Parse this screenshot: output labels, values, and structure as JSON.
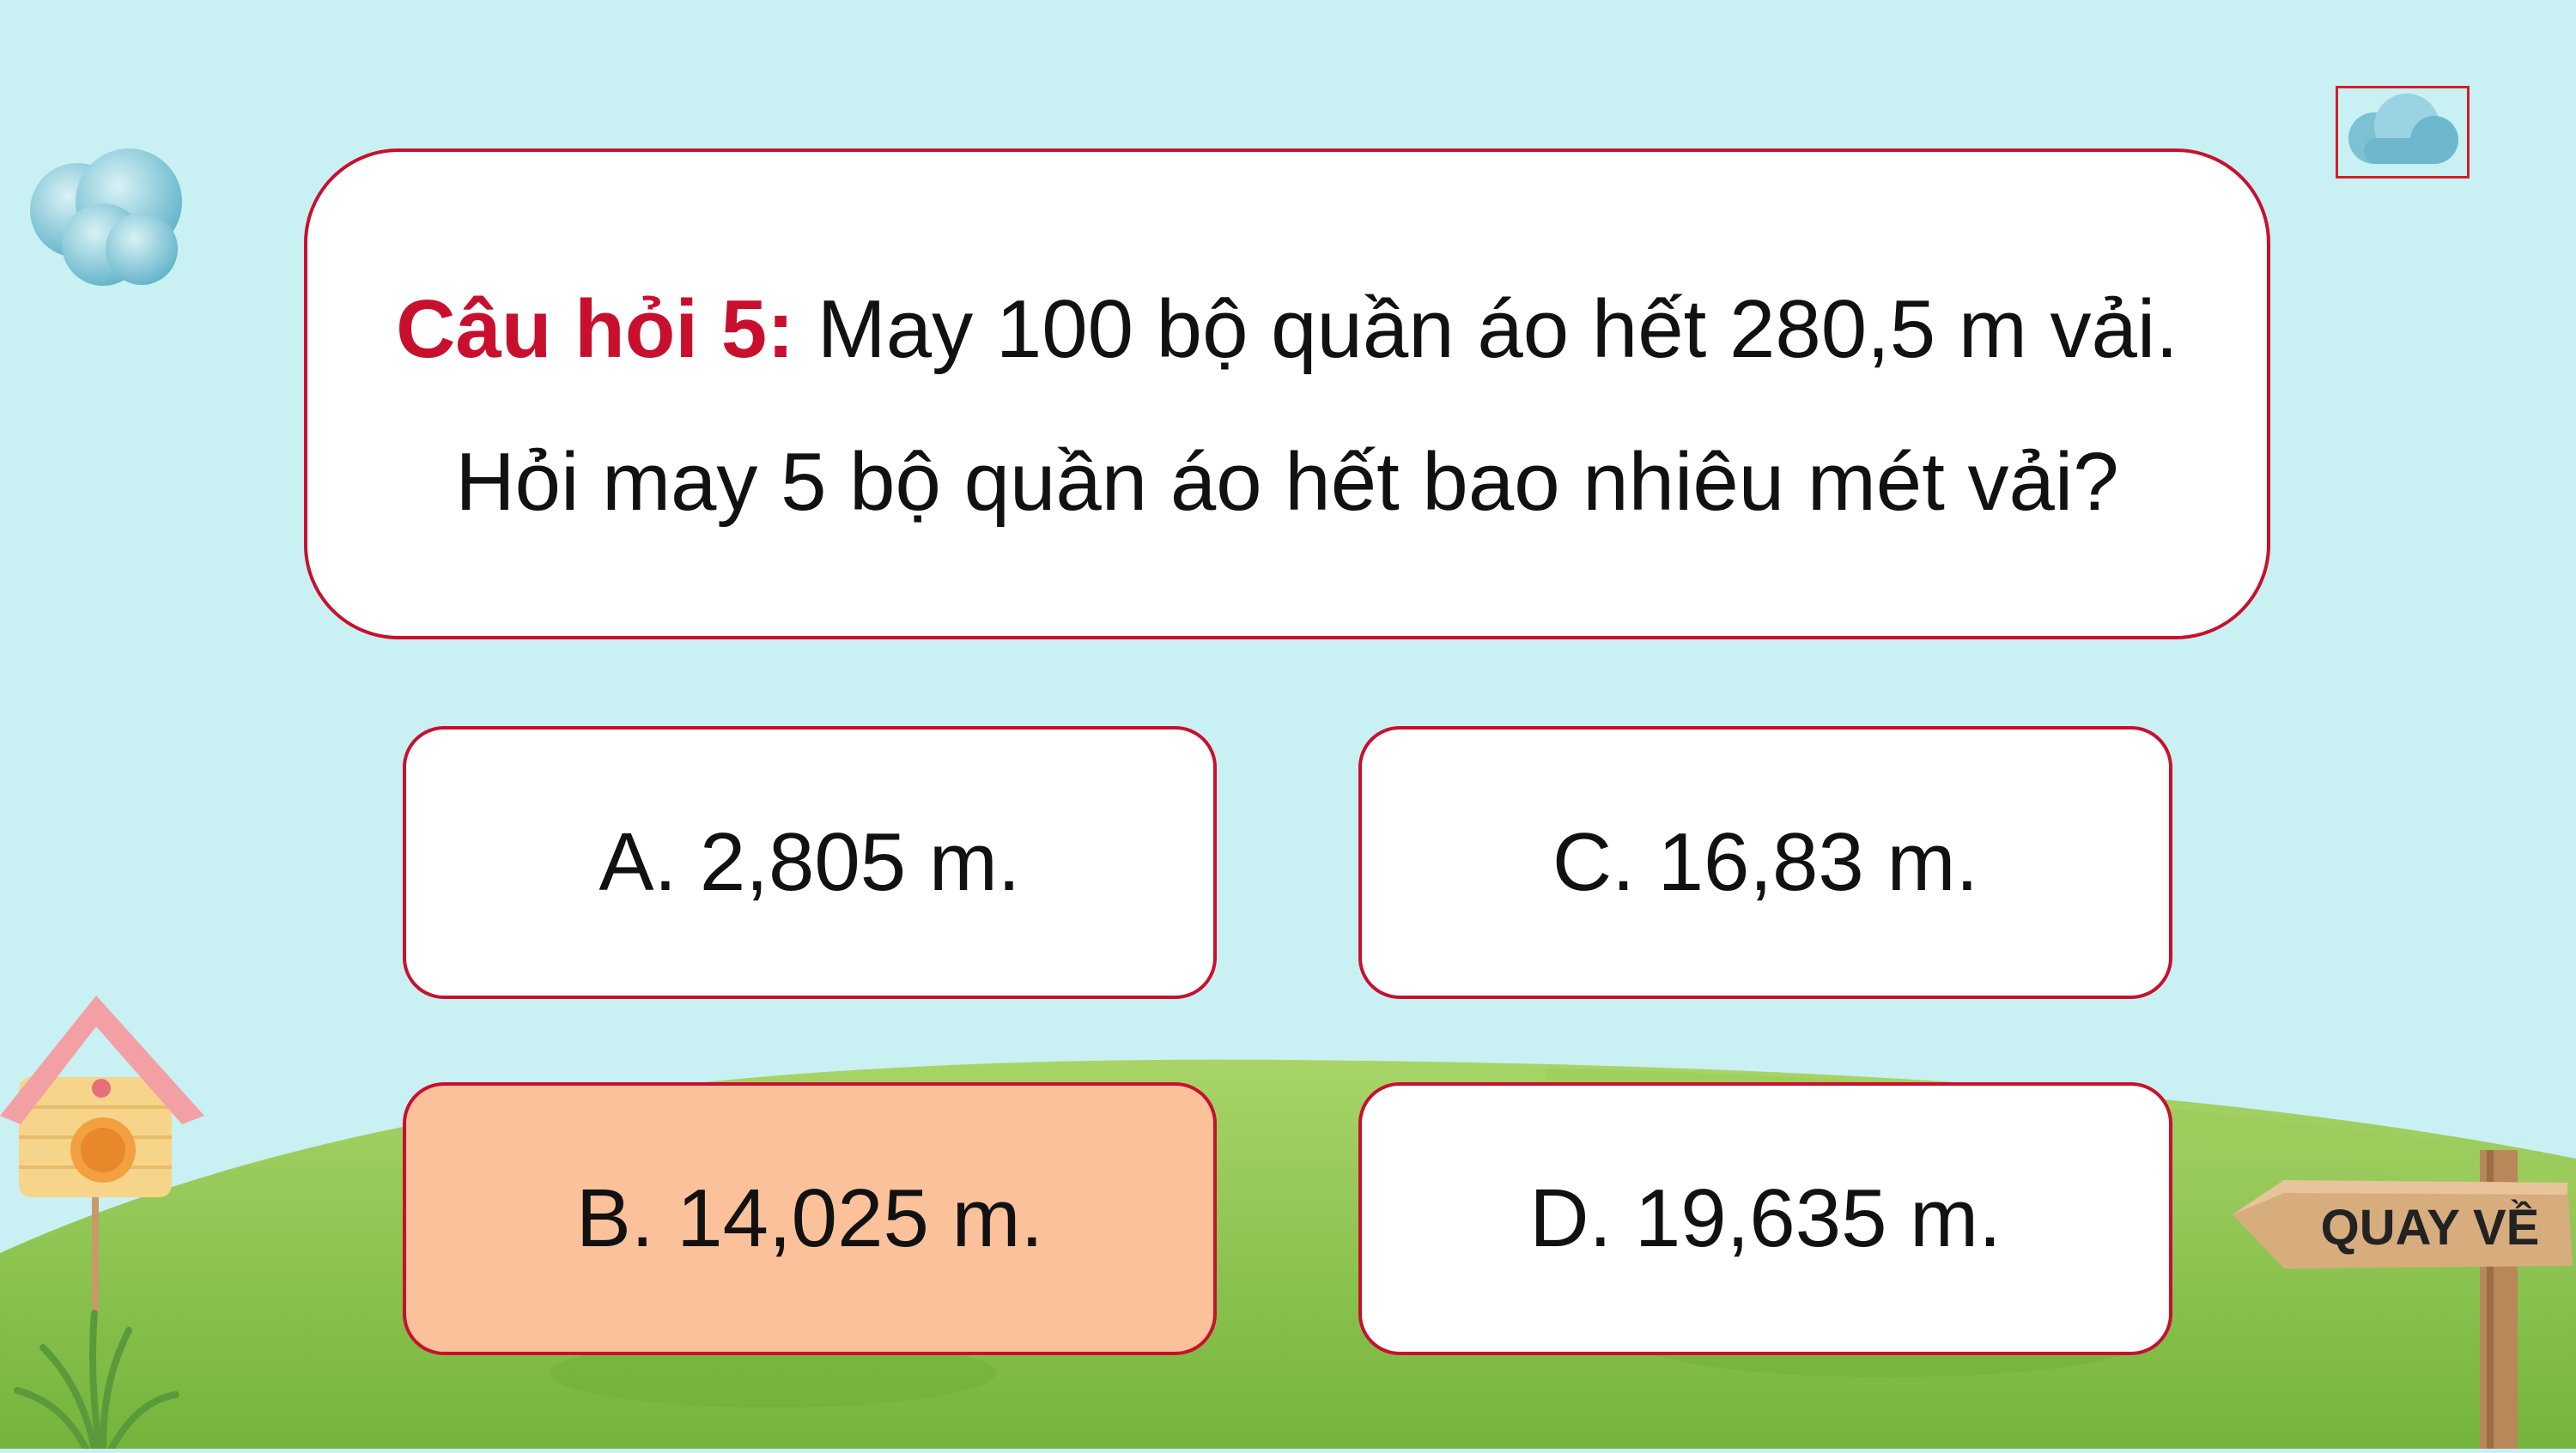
{
  "question": {
    "label": "Câu hỏi 5:",
    "line1_text": " May 100 bộ quần áo hết 280,5 m vải.",
    "line2_text": "Hỏi may 5 bộ quần áo hết bao nhiêu mét vải?"
  },
  "answers": [
    {
      "text": "A. 2,805 m.",
      "selected": false
    },
    {
      "text": "C. 16,83 m.",
      "selected": false
    },
    {
      "text": "B. 14,025 m.",
      "selected": true
    },
    {
      "text": "D. 19,635 m.",
      "selected": false
    }
  ],
  "back_button": {
    "label": "QUAY VỀ",
    "icon": "wooden-signpost-icon"
  },
  "cloud_button": {
    "icon": "cloud-icon"
  },
  "colors": {
    "sky": "#c9f0f2",
    "accent": "#c8102e",
    "selected_answer": "#fbc19b",
    "grass": "#8cc24c"
  }
}
